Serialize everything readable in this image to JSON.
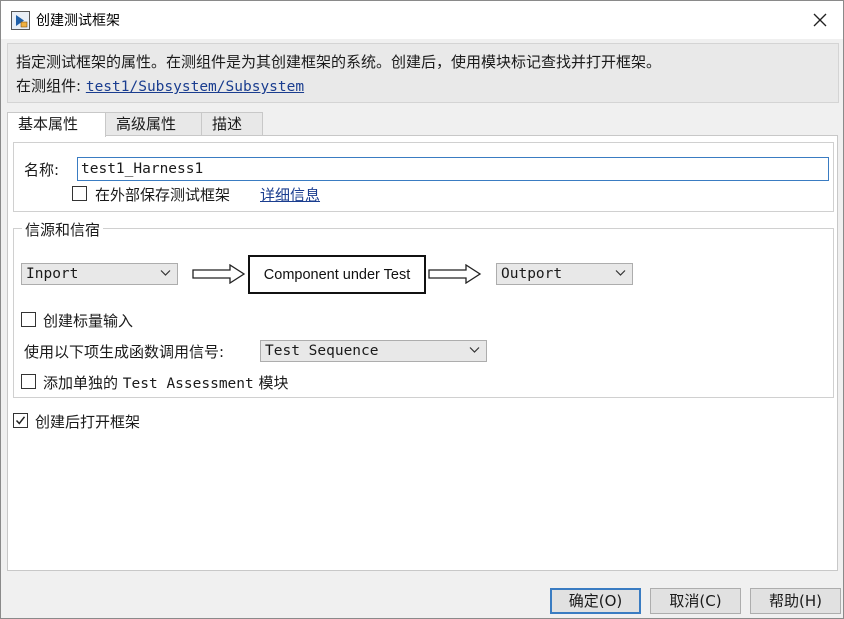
{
  "window": {
    "title": "创建测试框架",
    "close_icon": "close-icon",
    "app_icon": "simulink-harness-icon"
  },
  "info": {
    "description": "指定测试框架的属性。在测组件是为其创建框架的系统。创建后，使用模块标记查找并打开框架。",
    "component_label": "在测组件:",
    "component_path": "test1/Subsystem/Subsystem"
  },
  "tabs": [
    {
      "label": "基本属性",
      "active": true
    },
    {
      "label": "高级属性",
      "active": false
    },
    {
      "label": "描述",
      "active": false
    }
  ],
  "basic": {
    "name_label": "名称:",
    "name_value": "test1_Harness1",
    "save_external_label": "在外部保存测试框架",
    "save_external_checked": false,
    "details_link": "详细信息"
  },
  "sources_sinks": {
    "group_title": "信源和信宿",
    "source_value": "Inport",
    "component_box": "Component under Test",
    "sink_value": "Outport",
    "scalar_input_label": "创建标量输入",
    "scalar_input_checked": false,
    "function_call_label": "使用以下项生成函数调用信号:",
    "function_call_value": "Test Sequence",
    "assessment_label_prefix": "添加单独的",
    "assessment_label_mono": "Test Assessment",
    "assessment_label_suffix": "模块",
    "assessment_checked": false
  },
  "open_after": {
    "label": "创建后打开框架",
    "checked": true
  },
  "buttons": {
    "ok": "确定(O)",
    "cancel": "取消(C)",
    "help": "帮助(H)"
  }
}
